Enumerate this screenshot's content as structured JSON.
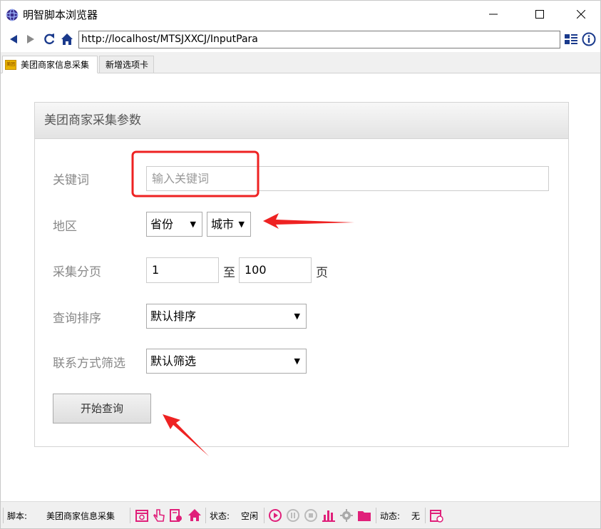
{
  "window": {
    "title": "明智脚本浏览器"
  },
  "navbar": {
    "url": "http://localhost/MTSJXXCJ/InputPara"
  },
  "tabs": [
    {
      "label": "美团商家信息采集",
      "icon_text": "美团"
    },
    {
      "label": "新增选项卡"
    }
  ],
  "panel": {
    "title": "美团商家采集参数",
    "keyword": {
      "label": "关键词",
      "placeholder": "输入关键词"
    },
    "region": {
      "label": "地区",
      "province": "省份",
      "city": "城市"
    },
    "paging": {
      "label": "采集分页",
      "from": "1",
      "to_text": "至",
      "to": "100",
      "unit": "页"
    },
    "sort": {
      "label": "查询排序",
      "selected": "默认排序"
    },
    "contact_filter": {
      "label": "联系方式筛选",
      "selected": "默认筛选"
    },
    "submit": "开始查询"
  },
  "statusbar": {
    "script_label": "脚本:",
    "script_name": "美团商家信息采集",
    "state_label": "状态:",
    "state_value": "空闲",
    "dynamic_label": "动态:",
    "dynamic_value": "无"
  },
  "colors": {
    "accent": "#e0207a",
    "annotation": "#ee2222"
  },
  "icons": [
    "back-icon",
    "forward-icon",
    "refresh-icon",
    "home-icon",
    "list-icon",
    "info-icon"
  ]
}
